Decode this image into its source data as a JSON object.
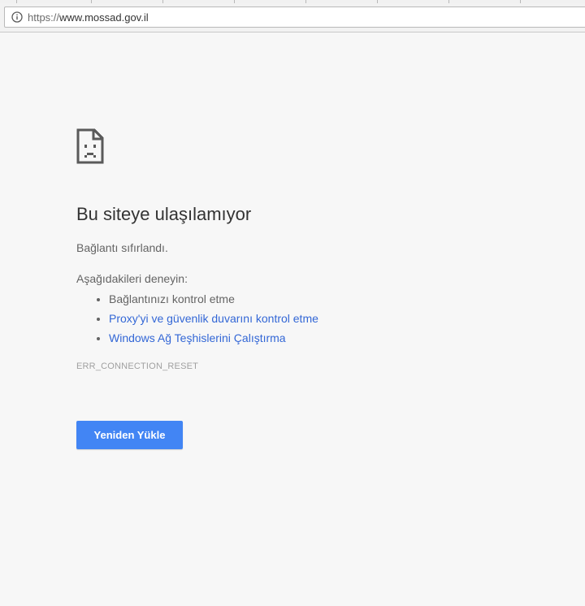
{
  "browser": {
    "url_scheme": "https://",
    "url_host": "www.mossad.gov.il",
    "info_icon": "info-circle-icon"
  },
  "error_page": {
    "icon": "sad-document-icon",
    "title": "Bu siteye ulaşılamıyor",
    "message": "Bağlantı sıfırlandı.",
    "try_header": "Aşağıdakileri deneyin:",
    "suggestions": [
      {
        "label": "Bağlantınızı kontrol etme",
        "is_link": false
      },
      {
        "label": "Proxy'yi ve güvenlik duvarını kontrol etme",
        "is_link": true
      },
      {
        "label": "Windows Ağ Teşhislerini Çalıştırma",
        "is_link": true
      }
    ],
    "error_code": "ERR_CONNECTION_RESET",
    "reload_label": "Yeniden Yükle"
  },
  "colors": {
    "background": "#f7f7f7",
    "link": "#3367d6",
    "button": "#4285f4"
  }
}
